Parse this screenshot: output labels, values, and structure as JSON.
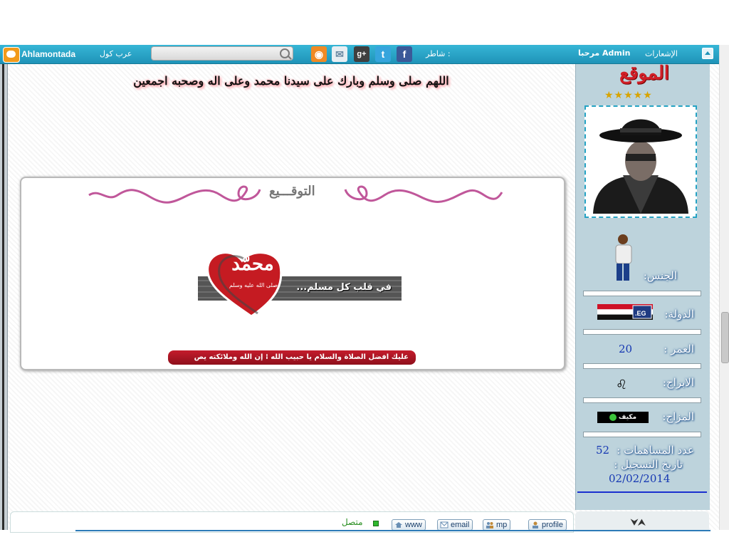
{
  "toolbar": {
    "brand": "Ahlamontada",
    "arab_kool": "عرب كول",
    "search_placeholder": "",
    "share_label": "شاطر :",
    "welcome": "مرحبا Admin",
    "notifications": "الإشعارات",
    "social_icons": [
      "rss-icon",
      "email-icon",
      "google-plus-icon",
      "twitter-icon",
      "facebook-icon"
    ]
  },
  "post": {
    "prayer": "اللهم صلى وسلم وبارك على سيدنا محمد وعلى اله وصحبه اجمعين",
    "signature_title": "التوقـــيع",
    "banner_name": "محمّد",
    "banner_sub": "صلى الله عليه وسلم",
    "banner_text": "في قلب كل مسلم...",
    "quote": "عليك افضل الصلاة والسلام يا حبيب الله  ⁞  إن الله وملائكته يص"
  },
  "profile": {
    "rank_title": "الموقع",
    "stars": "★★★★★",
    "gender_label": "الجنس:",
    "country_label": "الدولة:",
    "country_code": ".EG",
    "age_label": "العمر :",
    "age_value": "20",
    "zodiac_label": "الابراج:",
    "mood_label": "المزاج:",
    "mood_value": "مكيف",
    "posts_label": "عدد المساهمات :",
    "posts_value": "52",
    "registered_label": "تاريخ التسجيل :",
    "registered_value": "02/02/2014"
  },
  "footer": {
    "online": "متصل",
    "buttons": {
      "www": "www",
      "email": "email",
      "mp": "mp",
      "profile": "profile"
    }
  },
  "colors": {
    "toolbar": "#1f93b8",
    "profile_bg": "#bdd3dc",
    "accent_red": "#d01f27",
    "value_blue": "#1537b2"
  }
}
